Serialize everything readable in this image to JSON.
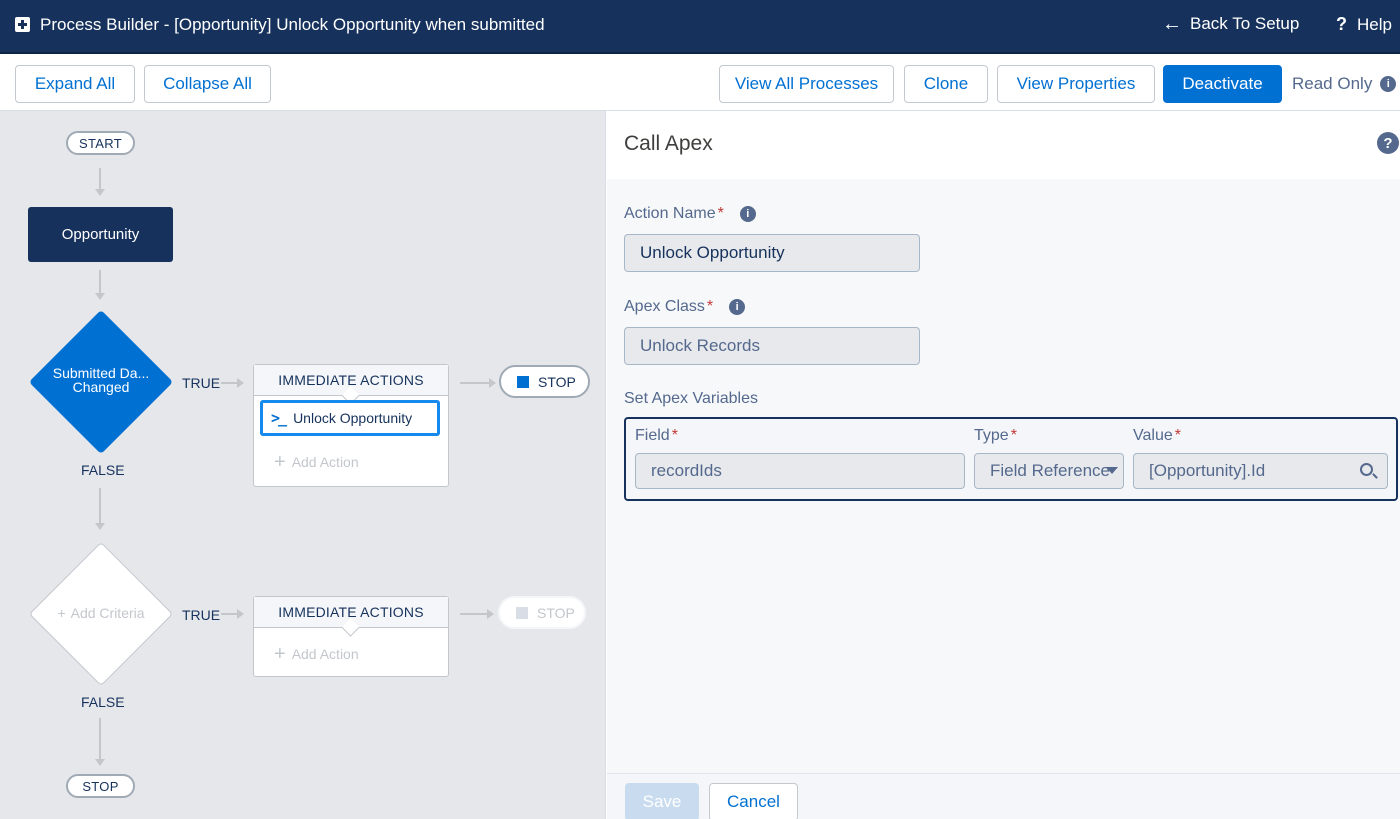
{
  "header": {
    "title": "Process Builder - [Opportunity] Unlock Opportunity when submitted",
    "back_label": "Back To Setup",
    "help_label": "Help"
  },
  "toolbar": {
    "expand_all": "Expand All",
    "collapse_all": "Collapse All",
    "view_all_processes": "View All Processes",
    "clone": "Clone",
    "view_properties": "View Properties",
    "deactivate": "Deactivate",
    "read_only": "Read Only"
  },
  "canvas": {
    "start_label": "START",
    "object_node": "Opportunity",
    "criteria_1": {
      "label_line1": "Submitted Da...",
      "label_line2": "Changed",
      "true_label": "TRUE",
      "false_label": "FALSE"
    },
    "actions_1": {
      "header": "IMMEDIATE ACTIONS",
      "action_icon": ">_",
      "action_label": "Unlock Opportunity",
      "add_action": "Add Action"
    },
    "stop_1": "STOP",
    "criteria_2": {
      "add_label": "Add Criteria",
      "true_label": "TRUE",
      "false_label": "FALSE"
    },
    "actions_2": {
      "header": "IMMEDIATE ACTIONS",
      "add_action": "Add Action"
    },
    "stop_2": "STOP",
    "stop_end": "STOP"
  },
  "panel": {
    "title": "Call Apex",
    "help_glyph": "?",
    "action_name_label": "Action Name",
    "action_name_value": "Unlock Opportunity",
    "apex_class_label": "Apex Class",
    "apex_class_value": "Unlock Records",
    "set_vars_label": "Set Apex Variables",
    "vars": {
      "field_header": "Field",
      "type_header": "Type",
      "value_header": "Value",
      "field_value": "recordIds",
      "type_value": "Field Reference",
      "value_value": "[Opportunity].Id"
    },
    "save_label": "Save",
    "cancel_label": "Cancel",
    "required_marker": "*",
    "info_glyph": "i"
  },
  "colors": {
    "header_bg": "#16325c",
    "brand_blue": "#0070d2",
    "canvas_bg": "#e6e7eb",
    "required_red": "#c23934"
  }
}
